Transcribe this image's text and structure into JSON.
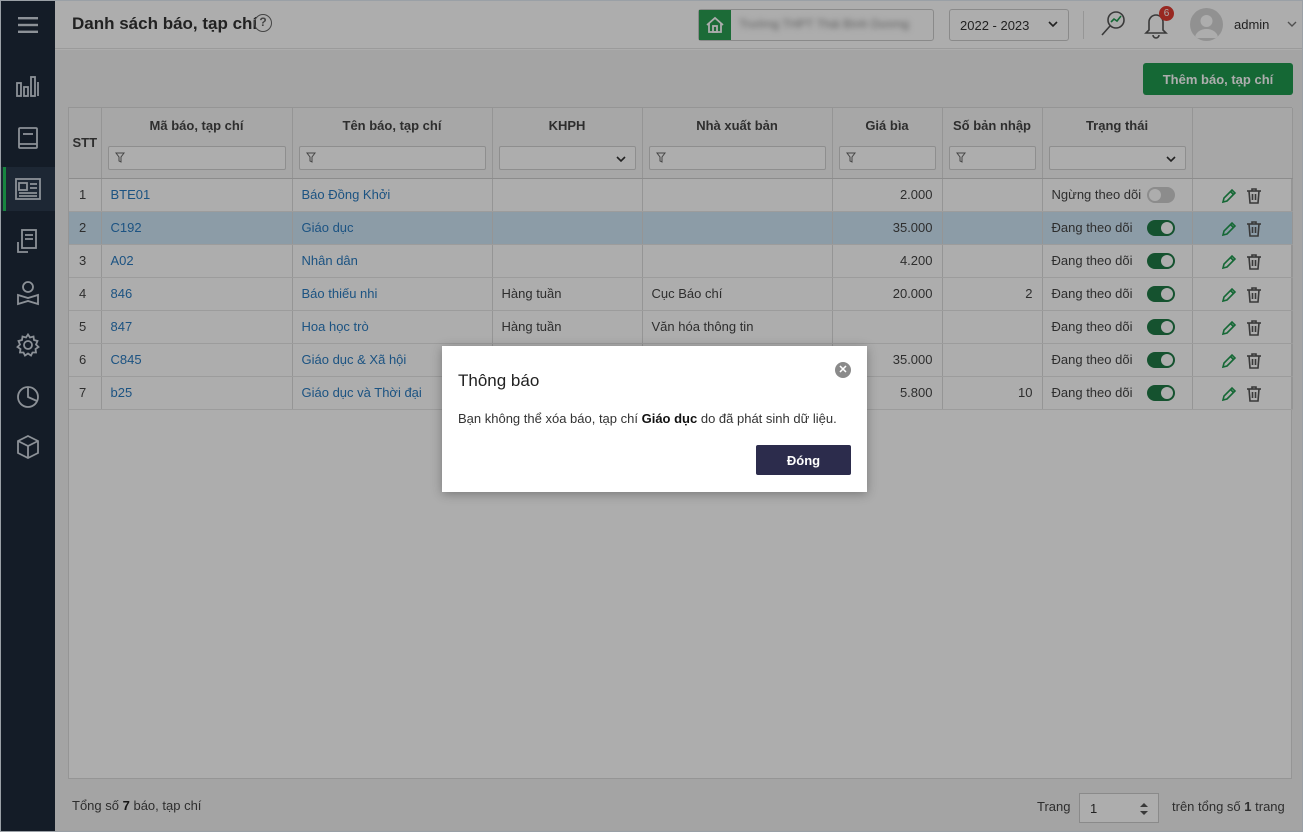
{
  "header": {
    "title": "Danh sách báo, tạp chí",
    "help_icon": "?",
    "school_name": "Trường THPT Thái Bình Dương",
    "year": "2022 - 2023",
    "notification_count": "6",
    "username": "admin"
  },
  "sidebar": {
    "items": [
      {
        "icon": "menu-icon"
      },
      {
        "icon": "bar-chart-icon"
      },
      {
        "icon": "book-icon"
      },
      {
        "icon": "newspaper-icon"
      },
      {
        "icon": "borrow-book-icon"
      },
      {
        "icon": "reader-icon"
      },
      {
        "icon": "gear-icon"
      },
      {
        "icon": "pie-chart-icon"
      },
      {
        "icon": "cube-icon"
      }
    ],
    "active_index": 3
  },
  "toolbar": {
    "add_label": "Thêm báo, tạp chí"
  },
  "table": {
    "columns": [
      "STT",
      "Mã báo, tạp chí",
      "Tên báo, tạp chí",
      "KHPH",
      "Nhà xuất bản",
      "Giá bìa",
      "Số bản nhập",
      "Trạng thái"
    ],
    "rows": [
      {
        "stt": "1",
        "ma": "BTE01",
        "ten": "Báo Đồng Khởi",
        "khph": "",
        "nxb": "",
        "gia": "2.000",
        "so": "",
        "status": "Ngừng theo dõi",
        "on": false
      },
      {
        "stt": "2",
        "ma": "C192",
        "ten": "Giáo dục",
        "khph": "",
        "nxb": "",
        "gia": "35.000",
        "so": "",
        "status": "Đang theo dõi",
        "on": true
      },
      {
        "stt": "3",
        "ma": "A02",
        "ten": "Nhân dân",
        "khph": "",
        "nxb": "",
        "gia": "4.200",
        "so": "",
        "status": "Đang theo dõi",
        "on": true
      },
      {
        "stt": "4",
        "ma": "846",
        "ten": "Báo thiếu nhi",
        "khph": "Hàng tuần",
        "nxb": "Cục Báo chí",
        "gia": "20.000",
        "so": "2",
        "status": "Đang theo dõi",
        "on": true
      },
      {
        "stt": "5",
        "ma": "847",
        "ten": "Hoa học trò",
        "khph": "Hàng tuần",
        "nxb": "Văn hóa thông tin",
        "gia": "",
        "so": "",
        "status": "Đang theo dõi",
        "on": true
      },
      {
        "stt": "6",
        "ma": "C845",
        "ten": "Giáo dục & Xã hội",
        "khph": "",
        "nxb": "",
        "gia": "35.000",
        "so": "",
        "status": "Đang theo dõi",
        "on": true
      },
      {
        "stt": "7",
        "ma": "b25",
        "ten": "Giáo dục và Thời đại",
        "khph": "",
        "nxb": "",
        "gia": "5.800",
        "so": "10",
        "status": "Đang theo dõi",
        "on": true
      }
    ],
    "selected_row": 1
  },
  "footer": {
    "total_prefix": "Tổng số",
    "total_count": "7",
    "total_suffix": "báo, tạp chí",
    "page_label": "Trang",
    "page_value": "1",
    "pages_prefix": "trên tổng số",
    "pages_count": "1",
    "pages_suffix": "trang"
  },
  "dialog": {
    "title": "Thông báo",
    "message_before": "Bạn không thể xóa báo, tạp chí",
    "message_bold": "Giáo dục",
    "message_after": "do đã phát sinh dữ liệu.",
    "close_label": "Đóng"
  },
  "colors": {
    "sidebar": "#1e2a3a",
    "accent_green": "#1f9a4f",
    "link": "#2a7bc0",
    "dialog_button": "#2c2c4c",
    "badge": "#e03c31"
  }
}
